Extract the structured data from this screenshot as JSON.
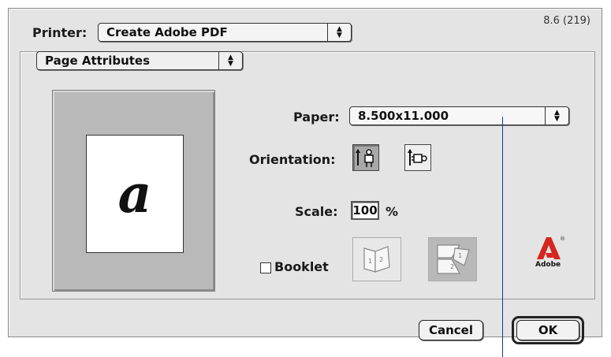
{
  "version": "8.6 (219)",
  "printer": {
    "label": "Printer:",
    "value": "Create Adobe PDF"
  },
  "panel": {
    "value": "Page Attributes"
  },
  "preview": {
    "glyph": "a"
  },
  "paper": {
    "label": "Paper:",
    "value": "8.500x11.000"
  },
  "orientation": {
    "label": "Orientation:",
    "selected": "portrait",
    "options": [
      "portrait",
      "landscape"
    ]
  },
  "scale": {
    "label": "Scale:",
    "value": "100",
    "unit": "%"
  },
  "booklet": {
    "label": "Booklet",
    "checked": false,
    "icons": [
      "1 2",
      "1 2"
    ]
  },
  "logo": {
    "text": "Adobe",
    "color": "#d4261e"
  },
  "buttons": {
    "cancel": "Cancel",
    "ok": "OK"
  },
  "colors": {
    "accent_line": "#123f8a"
  }
}
